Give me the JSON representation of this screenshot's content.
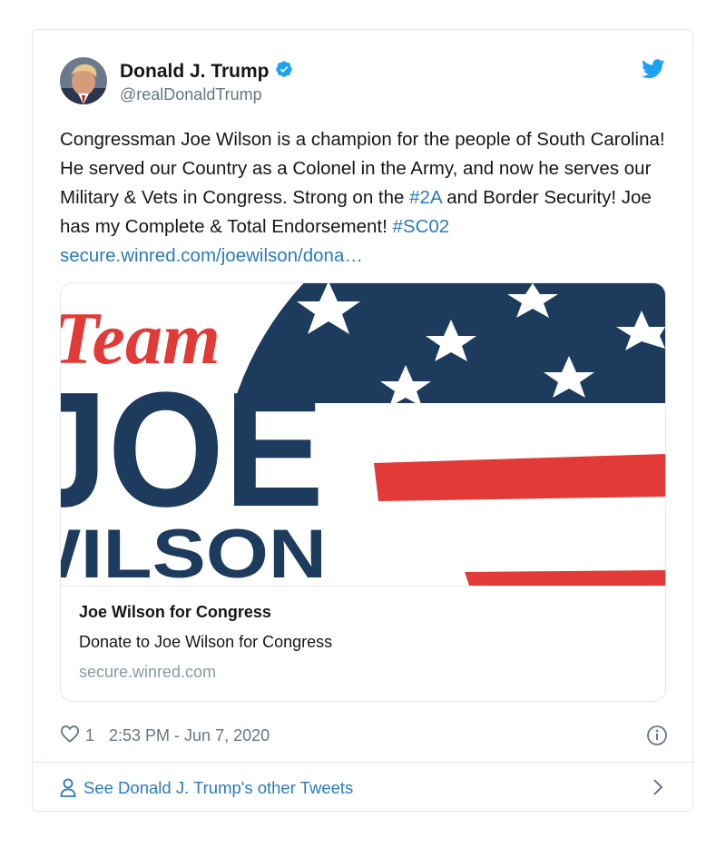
{
  "tweet": {
    "author_name": "Donald J. Trump",
    "author_handle": "@realDonaldTrump",
    "text_parts": [
      "Congressman Joe Wilson is a champion for the people of South Carolina! He served our Country as a Colonel in the Army, and now he serves our Military & Vets in Congress. Strong on the ",
      "#2A",
      " and Border Security! Joe has my Complete & Total Endorsement! ",
      "#SC02",
      " ",
      "secure.winred.com/joewilson/dona…"
    ],
    "like_count": "1",
    "timestamp": "2:53 PM - Jun 7, 2020",
    "see_other": "See Donald J. Trump's other Tweets"
  },
  "card": {
    "banner_team": "Team",
    "banner_joe": "JOE",
    "banner_wilson": "WILSON",
    "title": "Joe Wilson for Congress",
    "description": "Donate to Joe Wilson for Congress",
    "domain": "secure.winred.com"
  },
  "colors": {
    "link": "#2b7bb9",
    "verified": "#1da1f2",
    "navy": "#1d3b5c",
    "red": "#e23a36"
  },
  "icons": [
    "verified-badge-icon",
    "twitter-bird-icon",
    "heart-icon",
    "info-icon",
    "person-icon",
    "chevron-right-icon"
  ]
}
